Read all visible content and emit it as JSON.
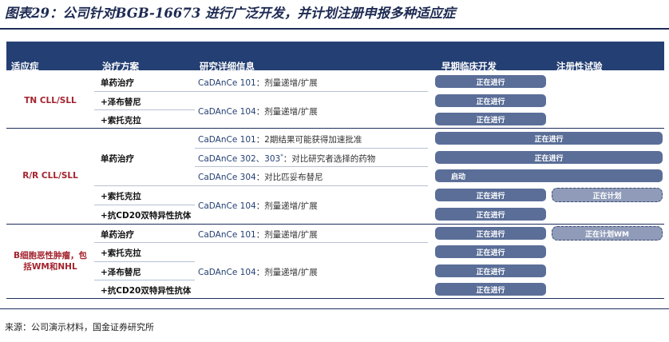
{
  "figure_title": "图表29：公司针对BGB-16673 进行广泛开发，并计划注册申报多种适应症",
  "headers": {
    "indication": "适应症",
    "therapy": "治疗方案",
    "study": "研究详细信息",
    "early": "早期临床开发",
    "registration": "注册性试验"
  },
  "indications": [
    "TN CLL/SLL",
    "R/R CLL/SLL",
    "B细胞恶性肿瘤，包括WM和NHL"
  ],
  "therapies": [
    "单药治疗",
    "+泽布替尼",
    "+索托克拉",
    "单药治疗",
    "+索托克拉",
    "+抗CD20双特异性抗体",
    "单药治疗",
    "+索托克拉",
    "+泽布替尼",
    "+抗CD20双特异性抗体"
  ],
  "studies": [
    {
      "code": "CaDAnCe 101",
      "desc": "：剂量递增/扩展"
    },
    {
      "code": "CaDAnCe 104",
      "desc": "：剂量递增/扩展"
    },
    {
      "code": "CaDAnCe 101",
      "desc": "：2期结果可能获得加速批准"
    },
    {
      "code": "CaDAnCe 302、303",
      "sup": "*",
      "desc": "：对比研究者选择的药物"
    },
    {
      "code": "CaDAnCe 304",
      "desc": "：对比匹妥布替尼"
    },
    {
      "code": "CaDAnCe 104",
      "desc": "：剂量递增/扩展"
    },
    {
      "code": "CaDAnCe 101",
      "desc": "：剂量递增/扩展"
    },
    {
      "code": "CaDAnCe 104",
      "desc": "：剂量递增/扩展"
    }
  ],
  "status_bars": [
    "正在进行",
    "正在进行",
    "正在进行",
    "正在进行",
    "正在进行",
    "启动",
    "正在进行",
    "正在计划",
    "正在进行",
    "正在进行",
    "正在计划WM",
    "正在进行",
    "正在进行",
    "正在进行"
  ],
  "colors": {
    "header_bg": "#243f73",
    "bar": "#5a6e98",
    "bar_planned": "#8f9bb8",
    "indication_text": "#a3232e",
    "title_text": "#1d2a52"
  },
  "source": "来源：公司演示材料，国金证券研究所"
}
